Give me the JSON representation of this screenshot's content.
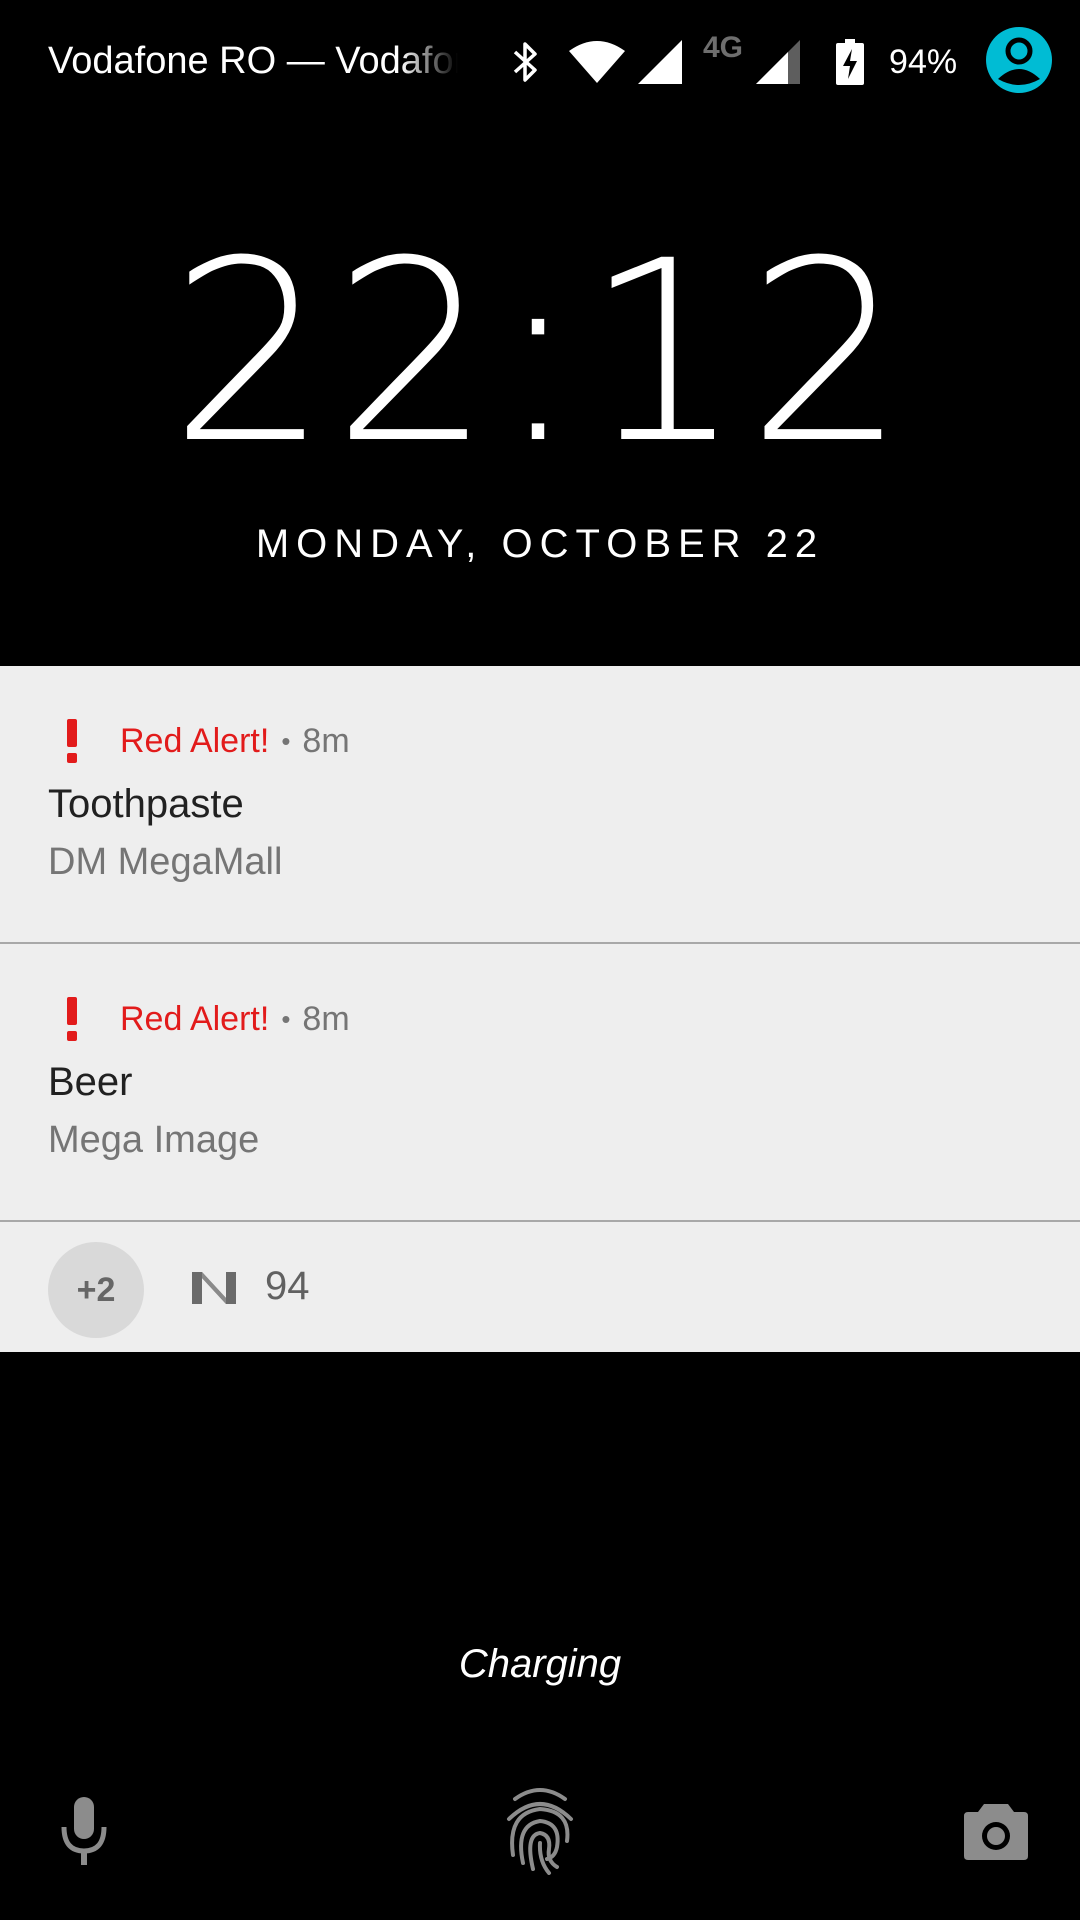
{
  "status_bar": {
    "carrier": "Vodafone RO — Vodafone RO",
    "network_type": "4G",
    "battery_percent": "94%",
    "battery_level": 0.94,
    "icons": [
      "bluetooth-icon",
      "wifi-icon",
      "signal-full-icon",
      "signal-partial-icon",
      "battery-charging-icon",
      "user-avatar-icon"
    ],
    "avatar_color": "#00bcd4"
  },
  "lockscreen": {
    "time": "22:12",
    "date": "MONDAY, OCTOBER 22",
    "charging_text": "Charging"
  },
  "notifications": [
    {
      "app_name": "Red Alert!",
      "separator": "•",
      "time": "8m",
      "title": "Toothpaste",
      "text": "DM MegaMall",
      "icon": "exclamation-icon"
    },
    {
      "app_name": "Red Alert!",
      "separator": "•",
      "time": "8m",
      "title": "Beer",
      "text": "Mega Image",
      "icon": "exclamation-icon"
    }
  ],
  "overflow": {
    "count_label": "+2",
    "icon": "n-app-icon",
    "value": "94"
  },
  "bottom_actions": [
    "microphone-icon",
    "fingerprint-icon",
    "camera-icon"
  ],
  "colors": {
    "accent_red": "#e21b1b",
    "notification_bg": "#eeeeee",
    "background": "#000000"
  }
}
